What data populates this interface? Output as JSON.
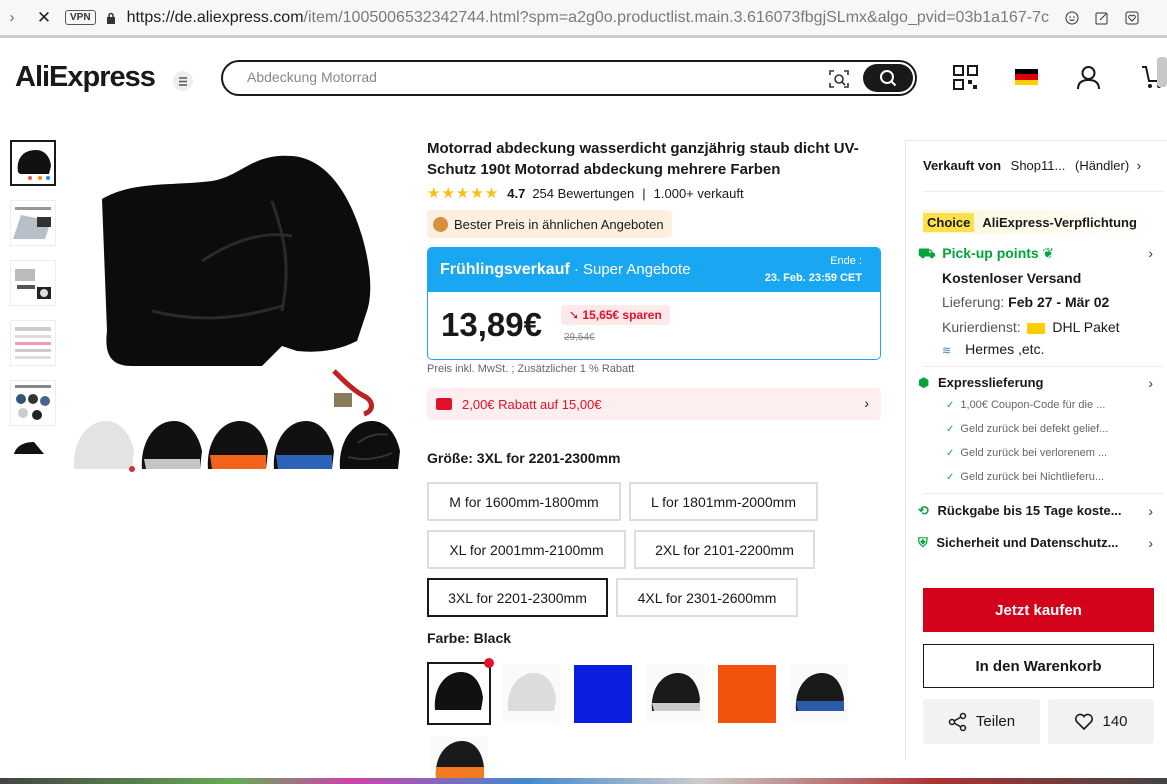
{
  "browser": {
    "vpn": "VPN",
    "url_domain": "https://de.aliexpress.com",
    "url_path": "/item/1005006532342744.html?spm=a2g0o.productlist.main.3.616073fbgjSLmx&algo_pvid=03b1a167-7c"
  },
  "header": {
    "logo": "AliExpress",
    "search_placeholder": "Abdeckung Motorrad"
  },
  "product": {
    "title": "Motorrad abdeckung wasserdicht ganzjährig staub dicht UV-Schutz 190t Motorrad abdeckung mehrere Farben",
    "rating": "4.7",
    "reviews": "254 Bewertungen",
    "sold": "1.000+ verkauft",
    "best_price": "Bester Preis in ähnlichen Angeboten"
  },
  "sale": {
    "title": "Frühlingsverkauf",
    "subtitle": "· Super Angebote",
    "ends_label": "Ende :",
    "ends_date": "23. Feb. 23:59 CET",
    "price": "13,89€",
    "save": "15,65€ sparen",
    "original": "29,54€",
    "tax_note": "Preis inkl. MwSt. ; Zusätzlicher 1 % Rabatt",
    "coupon": "2,00€ Rabatt auf 15,00€"
  },
  "size": {
    "label": "Größe: 3XL for 2201-2300mm",
    "options": [
      "M for 1600mm-1800mm",
      "L for 1801mm-2000mm",
      "XL for 2001mm-2100mm",
      "2XL for 2101-2200mm",
      "3XL for 2201-2300mm",
      "4XL for 2301-2600mm"
    ],
    "selected_index": 4
  },
  "color": {
    "label": "Farbe: Black",
    "swatches": [
      "#1a1a1a",
      "#d8d8d8",
      "#0a1ee0",
      "#333333",
      "#f2520e",
      "#2b5ba8",
      "#f27a20"
    ]
  },
  "sidebar": {
    "sold_by_label": "Verkauft von",
    "seller": "Shop11...",
    "seller_type": "(Händler)",
    "choice_tag": "Choice",
    "choice_text": "AliExpress-Verpflichtung",
    "pickup": "Pick-up points",
    "free_shipping": "Kostenloser Versand",
    "delivery_label": "Lieferung:",
    "delivery_dates": "Feb 27 - Mär 02",
    "courier_label": "Kurierdienst:",
    "courier_1": "DHL Paket",
    "courier_2": "Hermes ,etc.",
    "express": "Expresslieferung",
    "express_items": [
      "1,00€ Coupon-Code für die ...",
      "Geld zurück bei defekt gelief...",
      "Geld zurück bei verlorenem ...",
      "Geld zurück bei Nichtlieferu..."
    ],
    "returns": "Rückgabe bis 15 Tage koste...",
    "security": "Sicherheit und Datenschutz...",
    "buy": "Jetzt kaufen",
    "cart": "In den Warenkorb",
    "share": "Teilen",
    "wishlist": "140"
  },
  "colors": {
    "accent_red": "#d3031c",
    "sale_blue": "#1aa7f2",
    "green": "#00a43b",
    "star": "#fdbf0e"
  }
}
